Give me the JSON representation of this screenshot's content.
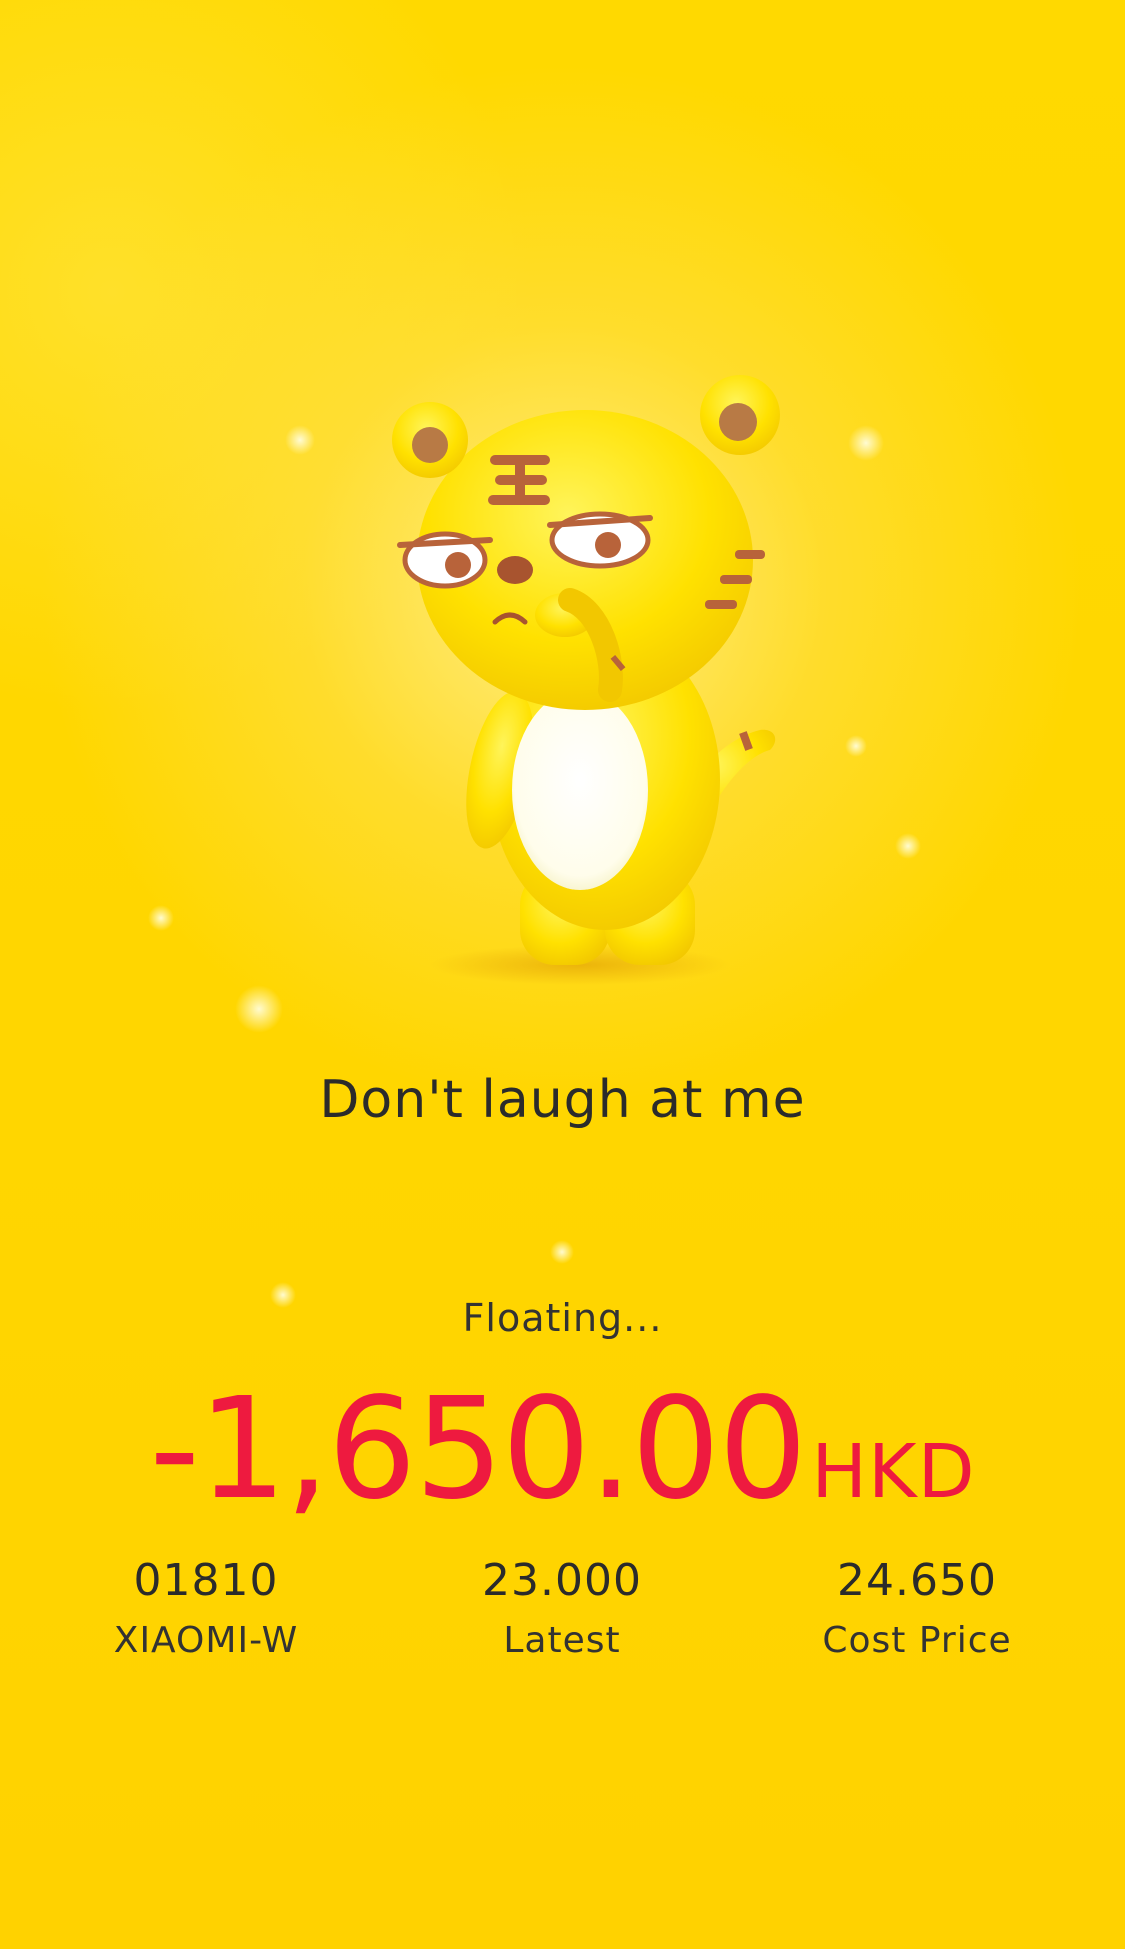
{
  "tagline": "Don't laugh at me",
  "status_label": "Floating...",
  "pnl": {
    "amount": "-1,650.00",
    "currency": "HKD"
  },
  "stats": [
    {
      "value": "01810",
      "label": "XIAOMI-W"
    },
    {
      "value": "23.000",
      "label": "Latest"
    },
    {
      "value": "24.650",
      "label": "Cost Price"
    }
  ],
  "colors": {
    "background": "#FFD500",
    "loss": "#EE1A3F",
    "text": "#2B2B2B"
  },
  "mascot": {
    "icon": "tiger-mascot-icon"
  }
}
